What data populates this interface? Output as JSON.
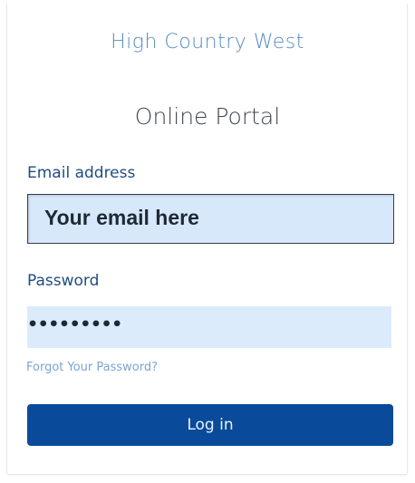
{
  "brand": {
    "name": "High Country West"
  },
  "page": {
    "title": "Online Portal"
  },
  "form": {
    "email": {
      "label": "Email address",
      "value": "Your email here"
    },
    "password": {
      "label": "Password",
      "value": "•••••••••"
    },
    "forgot_password_label": "Forgot Your Password?",
    "login_button_label": "Log in"
  },
  "colors": {
    "brand": "#5b8bc2",
    "label": "#1e4d84",
    "input_background": "#dcebfc",
    "button": "#0a4a9a",
    "link": "#7aa4d6"
  }
}
